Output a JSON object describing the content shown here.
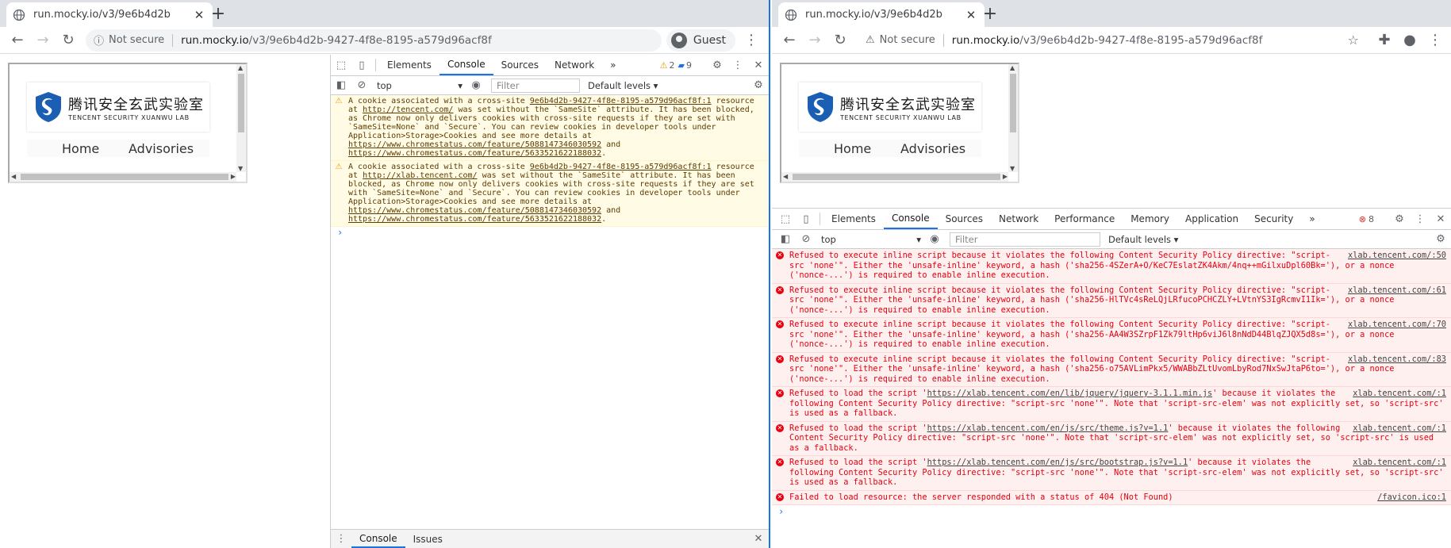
{
  "left": {
    "tab_title": "run.mocky.io/v3/9e6b4d2b",
    "not_secure": "Not secure",
    "url_host": "run.mocky.io",
    "url_path": "/v3/9e6b4d2b-9427-4f8e-8195-a579d96acf8f",
    "profile": "Guest",
    "devtools": {
      "tabs": [
        "Elements",
        "Console",
        "Sources",
        "Network"
      ],
      "more": "»",
      "warn_count": "2",
      "info_count": "9",
      "context": "top",
      "filter_placeholder": "Filter",
      "levels": "Default levels ▾",
      "messages": [
        {
          "source": "9e6b4d2b-9427-4f8e-8195-a579d96acf8f:1",
          "pre": "A cookie associated with a cross-site ",
          "link1": "http://tencent.com/",
          "mid": " resource at ",
          "text": " was set without the `SameSite` attribute. It has been blocked, as Chrome now only delivers cookies with cross-site requests if they are set with `SameSite=None` and `Secure`. You can review cookies in developer tools under Application>Storage>Cookies and see more details at ",
          "link2": "https://www.chromestatus.com/feature/5088147346030592",
          "and": " and ",
          "link3": "https://www.chromestatus.com/feature/5633521622188032",
          "end": "."
        },
        {
          "source": "9e6b4d2b-9427-4f8e-8195-a579d96acf8f:1",
          "pre": "A cookie associated with a cross-site ",
          "link1": "http://xlab.tencent.com/",
          "mid": " resource at ",
          "text": " was set without the `SameSite` attribute. It has been blocked, as Chrome now only delivers cookies with cross-site requests if they are set with `SameSite=None` and `Secure`. You can review cookies in developer tools under Application>Storage>Cookies and see more details at ",
          "link2": "https://www.chromestatus.com/feature/5088147346030592",
          "and": " and ",
          "link3": "https://www.chromestatus.com/feature/5633521622188032",
          "end": "."
        }
      ],
      "drawer_tabs": [
        "Console",
        "Issues"
      ]
    }
  },
  "right": {
    "tab_title": "run.mocky.io/v3/9e6b4d2b",
    "not_secure": "Not secure",
    "url_host": "run.mocky.io",
    "url_path": "/v3/9e6b4d2b-9427-4f8e-8195-a579d96acf8f",
    "devtools": {
      "tabs": [
        "Elements",
        "Console",
        "Sources",
        "Network",
        "Performance",
        "Memory",
        "Application",
        "Security"
      ],
      "more": "»",
      "error_count": "8",
      "context": "top",
      "filter_placeholder": "Filter",
      "levels": "Default levels ▾",
      "messages": [
        {
          "source": "xlab.tencent.com/:50",
          "text": "Refused to execute inline script because it violates the following Content Security Policy directive: \"script-src 'none'\". Either the 'unsafe-inline' keyword, a hash ('sha256-4SZerA+O/KeC7EslatZK4Akm/4nq++mGilxuDpl60Bk='), or a nonce ('nonce-...') is required to enable inline execution."
        },
        {
          "source": "xlab.tencent.com/:61",
          "text": "Refused to execute inline script because it violates the following Content Security Policy directive: \"script-src 'none'\". Either the 'unsafe-inline' keyword, a hash ('sha256-HlTVc4sReLQjLRfucoPCHCZLY+LVtnYS3IgRcmvI1Ik='), or a nonce ('nonce-...') is required to enable inline execution."
        },
        {
          "source": "xlab.tencent.com/:70",
          "text": "Refused to execute inline script because it violates the following Content Security Policy directive: \"script-src 'none'\". Either the 'unsafe-inline' keyword, a hash ('sha256-AA4W3SZrpF1Zk79ltHp6viJ6l8nNdD44BlqZJQX5d8s='), or a nonce ('nonce-...') is required to enable inline execution."
        },
        {
          "source": "xlab.tencent.com/:83",
          "text": "Refused to execute inline script because it violates the following Content Security Policy directive: \"script-src 'none'\". Either the 'unsafe-inline' keyword, a hash ('sha256-o75AVLimPkx5/WWABbZLtUvomLbyRod7NxSwJtaP6to='), or a nonce ('nonce-...') is required to enable inline execution."
        },
        {
          "source": "xlab.tencent.com/:1",
          "pre": "Refused to load the script '",
          "link": "https://xlab.tencent.com/en/lib/jquery/jquery-3.1.1.min.js",
          "text": "' because it violates the following Content Security Policy directive: \"script-src 'none'\". Note that 'script-src-elem' was not explicitly set, so 'script-src' is used as a fallback."
        },
        {
          "source": "xlab.tencent.com/:1",
          "pre": "Refused to load the script '",
          "link": "https://xlab.tencent.com/en/js/src/theme.js?v=1.1",
          "text": "' because it violates the following Content Security Policy directive: \"script-src 'none'\". Note that 'script-src-elem' was not explicitly set, so 'script-src' is used as a fallback."
        },
        {
          "source": "xlab.tencent.com/:1",
          "pre": "Refused to load the script '",
          "link": "https://xlab.tencent.com/en/js/src/bootstrap.js?v=1.1",
          "text": "' because it violates the following Content Security Policy directive: \"script-src 'none'\". Note that 'script-src-elem' was not explicitly set, so 'script-src' is used as a fallback."
        },
        {
          "source": "/favicon.ico:1",
          "text": "Failed to load resource: the server responded with a status of 404 (Not Found)"
        }
      ]
    }
  },
  "page": {
    "logo_cn": "腾讯安全玄武实验室",
    "logo_en": "TENCENT SECURITY XUANWU LAB",
    "nav_home": "Home",
    "nav_advisories": "Advisories"
  },
  "prompt": "›",
  "colors": {
    "accent": "#1a73e8",
    "error": "#e8000f",
    "warning": "#f29900"
  }
}
